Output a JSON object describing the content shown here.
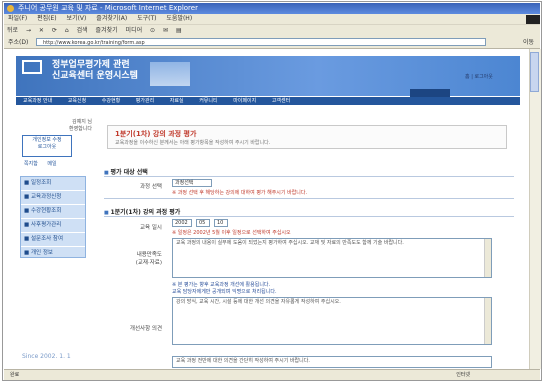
{
  "window": {
    "title": "주니어 공무원 교육 및 자료 - Microsoft Internet Explorer"
  },
  "menubar": {
    "items": [
      "파일(F)",
      "편집(E)",
      "보기(V)",
      "즐겨찾기(A)",
      "도구(T)",
      "도움말(H)"
    ]
  },
  "toolbar": {
    "items": [
      "뒤로",
      "→",
      "✕",
      "⟳",
      "⌂",
      "검색",
      "즐겨찾기",
      "미디어",
      "⊙",
      "✉",
      "▤"
    ]
  },
  "address": {
    "label": "주소(D)",
    "url": "http://www.korea.go.kr/training/form.asp",
    "go": "이동"
  },
  "site": {
    "name_line1": "정부업무평가제 관련",
    "name_line2": "신교육센터 운영시스템",
    "toplinks": "홈 | 로그아웃",
    "nav": [
      "교육과정 안내",
      "교육신청",
      "수강현황",
      "평가관리",
      "자료실",
      "커뮤니티",
      "마이페이지",
      "고객센터"
    ]
  },
  "sidebar": {
    "user_line1": "김예지 님",
    "user_line2": "환영합니다",
    "userbox_line1": "개인정보 수정",
    "userbox_line2": "로그아웃",
    "links": [
      "쪽지함",
      "메일"
    ],
    "menu": [
      "■ 일정조회",
      "■ 교육과정신청",
      "■ 수강현황조회",
      "■ 사후평가관리",
      "■ 설문조사 참여",
      "■ 개인 정보"
    ],
    "counter": "Since 2002. 1. 1"
  },
  "main": {
    "title": "1분기(1차) 강의 과정 평가",
    "subtitle": "교육과정을 이수하신 분께서는 아래 평가항목을 작성하여 주시기 바랍니다.",
    "section1": "평가 대상 선택",
    "field_course_label": "과정 선택",
    "field_course_value": "과정선택",
    "note1": "※ 과정 선택 후 해당하는 강의에 대하여 평가 해주시기 바랍니다.",
    "section2": "1분기(1차) 강의 과정 평가",
    "field_period_label": "교육 일시",
    "period_from": "2002",
    "period_mid": "05",
    "period_to": "10",
    "period_hint": "※ 일정은 2002년 5월 이후 일정으로 선택하여 주십시오",
    "field_content_label": "내용만족도\n(교재·자료)",
    "content_text": "교육 과정의 내용이 실무에 도움이 되었는지 평가하여 주십시오. 교재 및 자료의 만족도도 함께 기술 바랍니다.",
    "note2_line1": "※ 본 평가는 향후 교육과정 개선에 활용됩니다.",
    "note2_line2": "교육 담당자에게만 공개되며 익명으로 처리됩니다.",
    "field_opinion_label": "개선사항 의견",
    "opinion_text": "강의 방식, 교육 시간, 시설 등에 대한 개선 의견을 자유롭게 작성하여 주십시오.",
    "bottom_text": "교육 과정 전반에 대한 의견을 간단히 작성하여 주시기 바랍니다."
  },
  "statusbar": {
    "left": "완료",
    "right": "인터넷"
  }
}
